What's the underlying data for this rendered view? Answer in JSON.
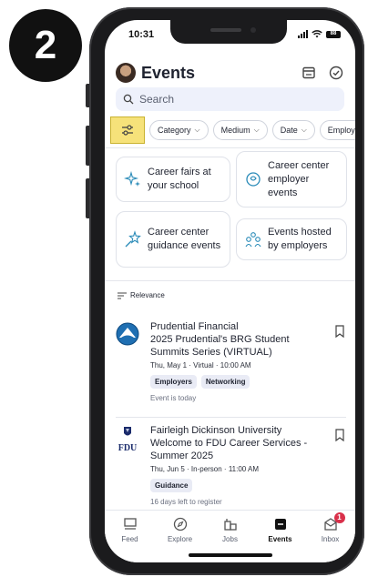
{
  "step_number": "2",
  "status_bar": {
    "time": "10:31",
    "battery": "88"
  },
  "header": {
    "title": "Events"
  },
  "search": {
    "placeholder": "Search"
  },
  "filters": {
    "chips": [
      "Category",
      "Medium",
      "Date",
      "Employ"
    ]
  },
  "categories": [
    {
      "label": "Career fairs at your school",
      "icon": "sparkle-icon"
    },
    {
      "label": "Career center employer events",
      "icon": "chat-icon"
    },
    {
      "label": "Career center guidance events",
      "icon": "star-arrow-icon"
    },
    {
      "label": "Events hosted by employers",
      "icon": "people-icon"
    }
  ],
  "sort": {
    "label": "Relevance"
  },
  "events": [
    {
      "org": "Prudential Financial",
      "title": "2025 Prudential's BRG Student Summits Series (VIRTUAL)",
      "meta": "Thu, May 1 · Virtual · 10:00 AM",
      "tags": [
        "Employers",
        "Networking"
      ],
      "note": "Event is today",
      "logo": "prudential-logo-icon"
    },
    {
      "org": "Fairleigh Dickinson University",
      "title": "Welcome to FDU Career Services - Summer 2025",
      "meta": "Thu, Jun 5 · In-person · 11:00 AM",
      "tags": [
        "Guidance"
      ],
      "note": "16 days left to register",
      "logo_text": "FDU"
    }
  ],
  "tabbar": {
    "tabs": [
      {
        "label": "Feed",
        "icon": "feed-icon"
      },
      {
        "label": "Explore",
        "icon": "compass-icon"
      },
      {
        "label": "Jobs",
        "icon": "briefcase-icon"
      },
      {
        "label": "Events",
        "icon": "calendar-icon",
        "active": true
      },
      {
        "label": "Inbox",
        "icon": "inbox-icon",
        "badge": "1"
      }
    ]
  },
  "colors": {
    "highlight": "#f6e27a",
    "accent_badge": "#d9304a",
    "search_bg": "#eef1fb"
  }
}
